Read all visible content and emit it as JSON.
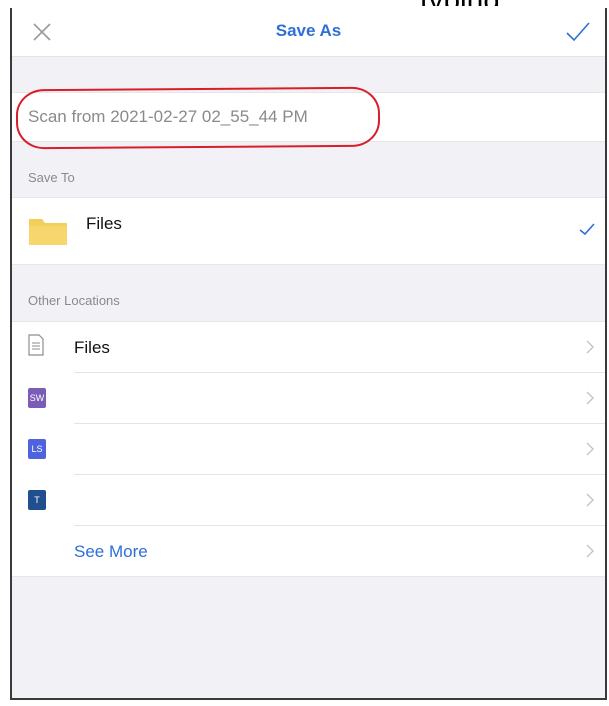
{
  "window_title": "Save As",
  "file_name": {
    "value": "Scan from 2021-02-27 02_55_44 PM"
  },
  "save_to": {
    "header": "Save To",
    "location": {
      "label": "Files",
      "icon": "folder-icon",
      "selected": true
    }
  },
  "other_locations": {
    "header": "Other Locations",
    "items": [
      {
        "label": "Files",
        "icon": "document-icon"
      },
      {
        "label": "",
        "badge": "SW",
        "badge_color": "#7b5db8"
      },
      {
        "label": "",
        "badge": "LS",
        "badge_color": "#4f63df"
      },
      {
        "label": "",
        "badge": "T",
        "badge_color": "#1f4f8f"
      }
    ],
    "see_more": "See More"
  },
  "colors": {
    "accent": "#2f6fd6",
    "annotation": "#d81e2a"
  }
}
